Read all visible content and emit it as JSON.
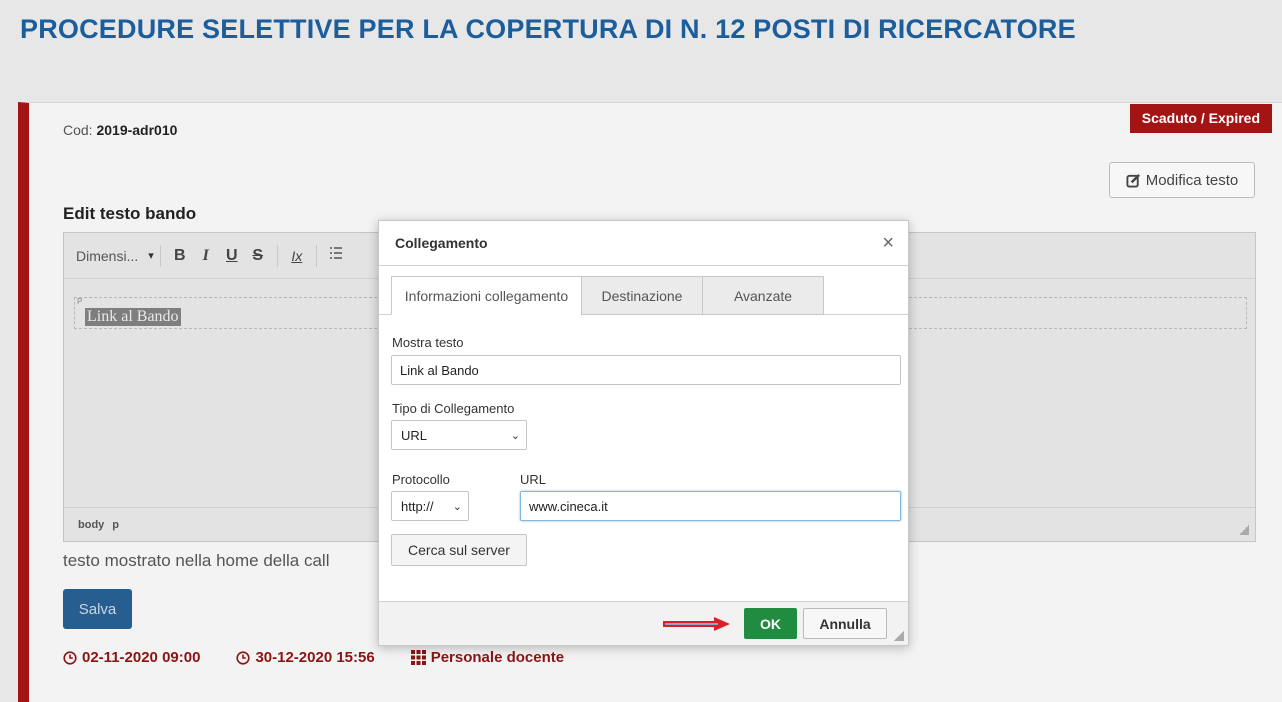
{
  "page": {
    "title": "PROCEDURE SELETTIVE PER LA COPERTURA DI N. 12 POSTI DI RICERCATORE"
  },
  "card": {
    "status_badge": "Scaduto / Expired",
    "cod_label": "Cod:",
    "cod_value": "2019-adr010",
    "edit_button": "Modifica testo",
    "edit_title": "Edit testo bando",
    "hint": "testo mostrato nella home della call",
    "save_button": "Salva",
    "meta": {
      "start": "02-11-2020 09:00",
      "end": "30-12-2020 15:56",
      "category": "Personale docente"
    }
  },
  "editor": {
    "font_size_combo": "Dimensi...",
    "toolbar": {
      "bold": "B",
      "italic": "I",
      "underline": "U",
      "strike": "S",
      "remove_format": "Ix"
    },
    "content_tag": "P",
    "content_text": "Link al Bando",
    "path": {
      "body": "body",
      "p": "p"
    }
  },
  "dialog": {
    "title": "Collegamento",
    "close_glyph": "×",
    "tabs": [
      "Informazioni collegamento",
      "Destinazione",
      "Avanzate"
    ],
    "display_text_label": "Mostra testo",
    "display_text_value": "Link al Bando",
    "link_type_label": "Tipo di Collegamento",
    "link_type_value": "URL",
    "protocol_label": "Protocollo",
    "protocol_value": "http://",
    "url_label": "URL",
    "url_value": "www.cineca.it",
    "browse_button": "Cerca sul server",
    "ok_button": "OK",
    "cancel_button": "Annulla"
  },
  "colors": {
    "brand_blue": "#1c5d9c",
    "expired_red": "#a31515",
    "ok_green": "#1f8c3f",
    "save_blue": "#265e90",
    "annotation_arrow": "#d7202a"
  }
}
